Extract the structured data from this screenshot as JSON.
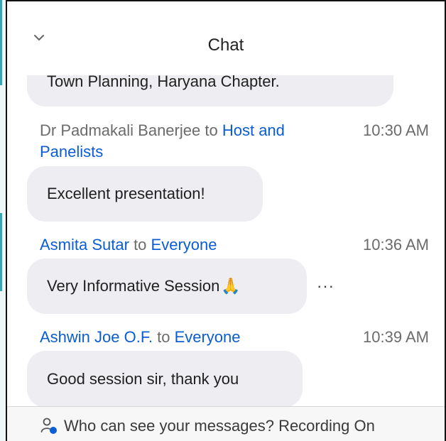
{
  "header": {
    "title": "Chat",
    "collapse_icon": "chevron-down-icon"
  },
  "messages": [
    {
      "text": "Town Planning, Haryana Chapter."
    },
    {
      "sender": "Dr Padmakali Banerjee",
      "to_word": "to",
      "recipient": "Host and Panelists",
      "time": "10:30 AM",
      "text": "Excellent presentation!"
    },
    {
      "sender": "Asmita Sutar",
      "to_word": "to",
      "recipient": "Everyone",
      "time": "10:36 AM",
      "text": "Very Informative Session",
      "emoji": "🙏",
      "more_label": "···"
    },
    {
      "sender": "Ashwin Joe O.F.",
      "to_word": "to",
      "recipient": "Everyone",
      "time": "10:39 AM",
      "text": "Good session sir, thank you"
    }
  ],
  "footer": {
    "icon": "person-privacy-icon",
    "text": "Who can see your messages?",
    "recording": "Recording On"
  },
  "colors": {
    "link_blue": "#0b5cd5",
    "bubble_bg": "#eeeef2",
    "muted_text": "#6b6b6b"
  }
}
